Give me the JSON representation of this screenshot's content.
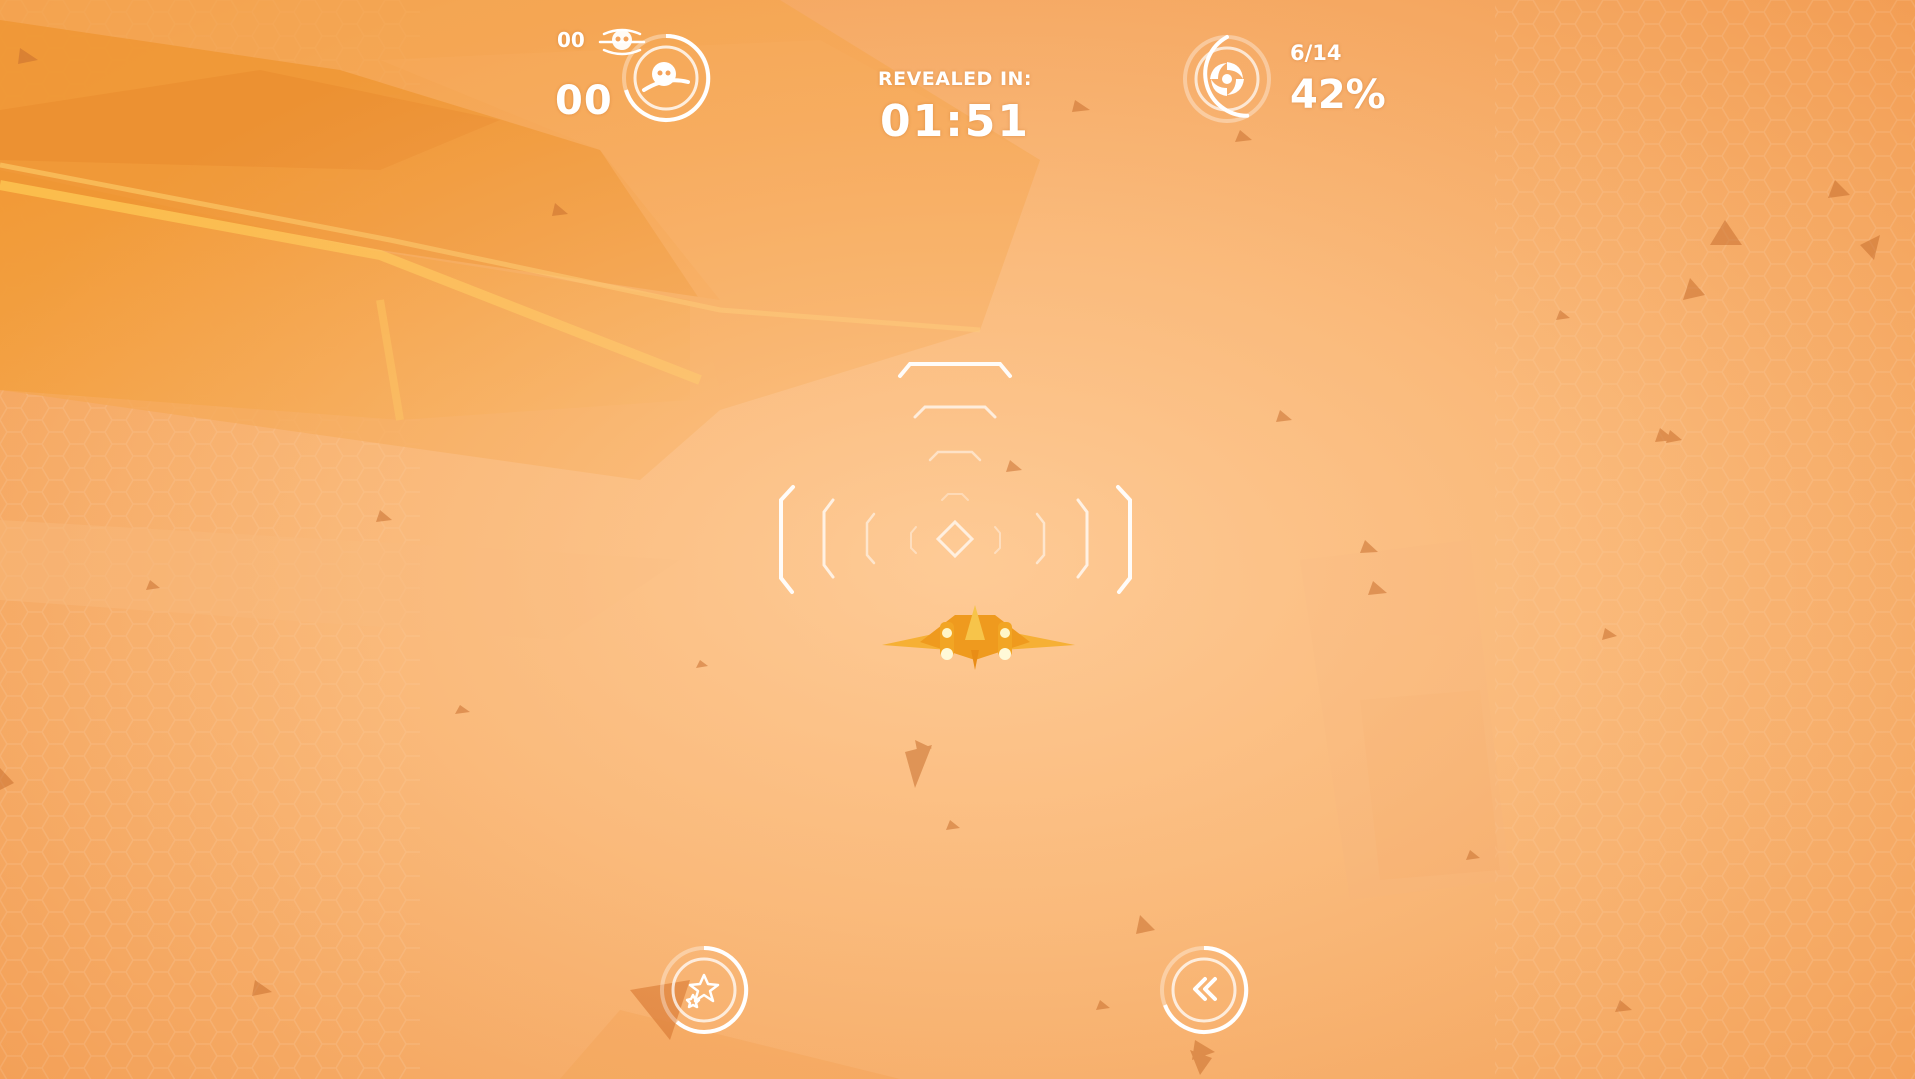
{
  "hud": {
    "kills_small": "00",
    "kills_big": "00",
    "revealed_label": "REVEALED IN:",
    "revealed_timer": "01:51",
    "progress_count": "6/14",
    "progress_percent": "42%",
    "progress_fraction": 0.42
  },
  "icons": {
    "kills_icon": "skull-crossed-icon",
    "target_icon": "skull-ring-icon",
    "vortex_icon": "vortex-icon",
    "ability_burst_icon": "burst-stars-icon",
    "ability_boost_icon": "double-chevron-left-icon"
  },
  "colors": {
    "sky": "#f9b878",
    "rock": "#f09a3c",
    "hud": "#ffffff",
    "ship": "#f4a21e"
  }
}
